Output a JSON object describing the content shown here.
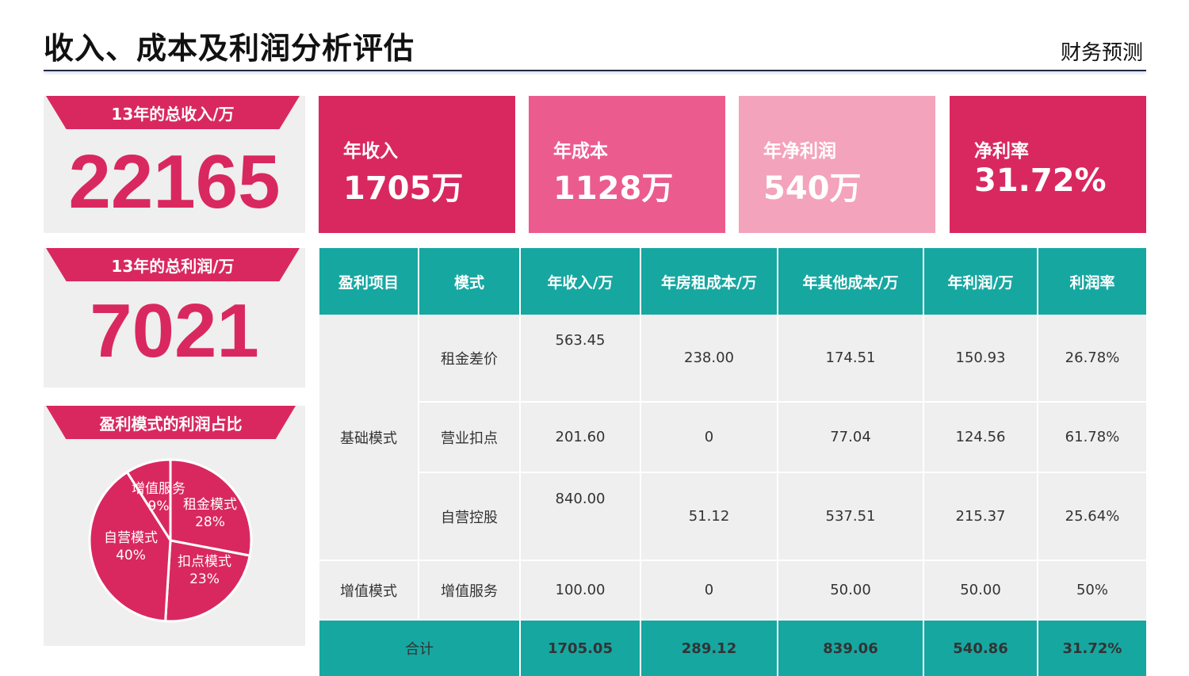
{
  "header": {
    "title": "收入、成本及利润分析评估",
    "section": "财务预测"
  },
  "summary": {
    "total_revenue_label": "13年的总收入/万",
    "total_revenue_value": "22165",
    "total_profit_label": "13年的总利润/万",
    "total_profit_value": "7021"
  },
  "kpis": [
    {
      "label": "年收入",
      "value": "1705万",
      "color": "#d9285f"
    },
    {
      "label": "年成本",
      "value": "1128万",
      "color": "#ec5b8d"
    },
    {
      "label": "年净利润",
      "value": "540万",
      "color": "#f4a3bc"
    },
    {
      "label": "净利率",
      "value": "31.72%",
      "color": "#d9285f"
    }
  ],
  "pie": {
    "title": "盈利模式的利润占比",
    "color": "#d9285f",
    "slices": [
      {
        "name": "增值服务",
        "pct_text": "9%",
        "value": 9
      },
      {
        "name": "租金模式",
        "pct_text": "28%",
        "value": 28
      },
      {
        "name": "扣点模式",
        "pct_text": "23%",
        "value": 23
      },
      {
        "name": "自营模式",
        "pct_text": "40%",
        "value": 40
      }
    ]
  },
  "table": {
    "headers": [
      "盈利项目",
      "模式",
      "年收入/万",
      "年房租成本/万",
      "年其他成本/万",
      "年利润/万",
      "利润率"
    ],
    "categories": {
      "basic": "基础模式",
      "value_added": "增值模式"
    },
    "rows": [
      {
        "mode": "租金差价",
        "revenue": "563.45",
        "rent": "238.00",
        "other": "174.51",
        "profit": "150.93",
        "rate": "26.78%"
      },
      {
        "mode": "营业扣点",
        "revenue": "201.60",
        "rent": "0",
        "other": "77.04",
        "profit": "124.56",
        "rate": "61.78%"
      },
      {
        "mode": "自营控股",
        "revenue": "840.00",
        "rent": "51.12",
        "other": "537.51",
        "profit": "215.37",
        "rate": "25.64%"
      },
      {
        "mode": "增值服务",
        "revenue": "100.00",
        "rent": "0",
        "other": "50.00",
        "profit": "50.00",
        "rate": "50%"
      }
    ],
    "total": {
      "label": "合计",
      "revenue": "1705.05",
      "rent": "289.12",
      "other": "839.06",
      "profit": "540.86",
      "rate": "31.72%"
    },
    "header_color": "#16a7a1"
  }
}
